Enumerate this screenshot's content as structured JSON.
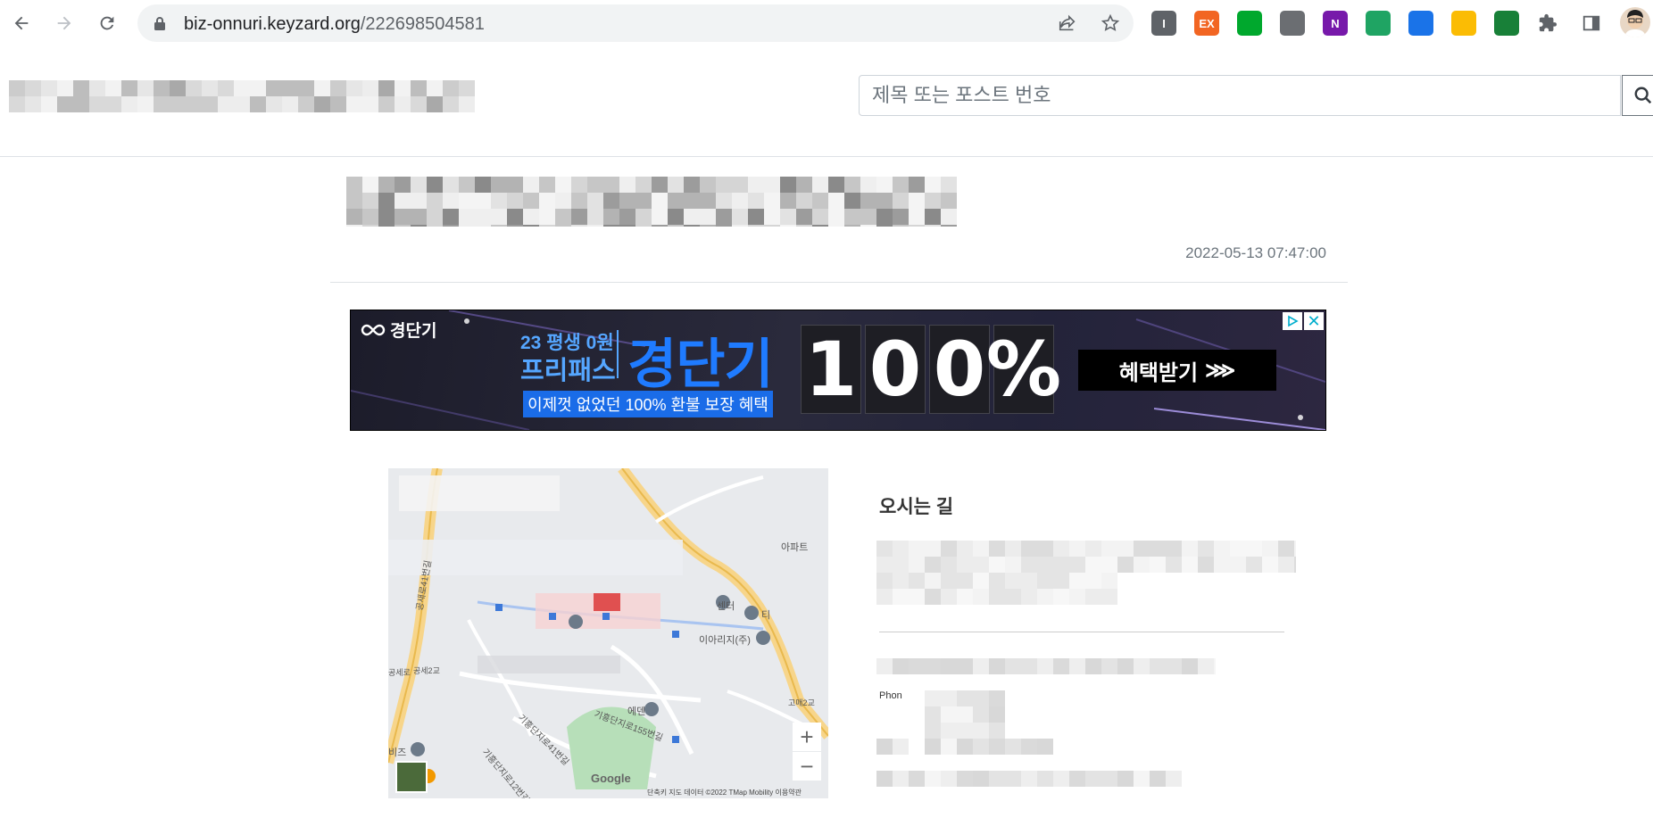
{
  "browser": {
    "url_host": "biz-onnuri.keyzard.org",
    "url_path": "/222698504581",
    "extensions": [
      {
        "name": "instapaper",
        "label": "I",
        "color": "#5f6368"
      },
      {
        "name": "ex",
        "label": "EX",
        "color": "#f26522"
      },
      {
        "name": "evernote",
        "label": "",
        "color": "#00a82d"
      },
      {
        "name": "notes",
        "label": "",
        "color": "#6b6e72"
      },
      {
        "name": "onenote",
        "label": "N",
        "color": "#7719aa"
      },
      {
        "name": "google-drive",
        "label": "",
        "color": "#1fa463"
      },
      {
        "name": "photos",
        "label": "",
        "color": "#1a73e8"
      },
      {
        "name": "emoji",
        "label": "",
        "color": "#fbbc04"
      },
      {
        "name": "pen",
        "label": "",
        "color": "#188038"
      }
    ]
  },
  "header": {
    "search_placeholder": "제목 또는 포스트 번호"
  },
  "post": {
    "date": "2022-05-13 07:47:00"
  },
  "ad": {
    "logo": "경단기",
    "line1": "23 평생 0원",
    "line2": "프리패스",
    "brand": "경단기",
    "strip": "이제껏 없었던 100% 환불 보장 혜택",
    "digits": [
      "1",
      "0",
      "0",
      "%"
    ],
    "cta": "혜택받기",
    "cta_arrows": "⋙",
    "close": "✕"
  },
  "map": {
    "labels": {
      "apt": "아파트",
      "center": "센터",
      "ti": "티",
      "company": "이아리지(주)",
      "road1": "공세2교",
      "road2": "고매2교",
      "road3": "공세로",
      "station": "에덴",
      "street1": "기흥단지로41번길",
      "street2": "기흥단지로12번길",
      "street3": "기흥단지로155번길",
      "biz": "비즈",
      "new": "공새로41번길"
    },
    "zoom_in": "+",
    "zoom_out": "−",
    "google": "Google",
    "attribution": "단축키   지도 데이터 ©2022 TMap Mobility   이용약관"
  },
  "info": {
    "heading": "오시는 길",
    "phone_label": "Phon"
  }
}
